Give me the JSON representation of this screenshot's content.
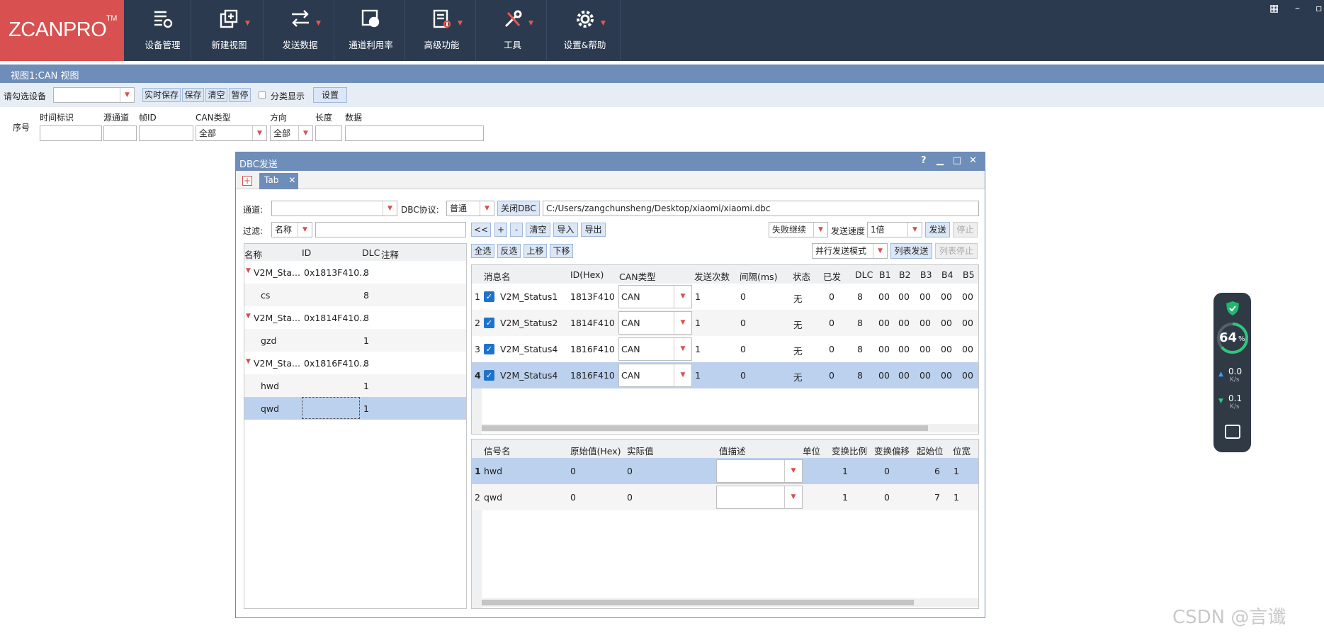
{
  "app": {
    "logo": "ZCANPRO",
    "logo_tm": "TM",
    "toolbar": [
      {
        "label": "设备管理",
        "icon": "device-manage-icon",
        "caret": false
      },
      {
        "label": "新建视图",
        "icon": "new-view-icon",
        "caret": true
      },
      {
        "label": "发送数据",
        "icon": "send-data-icon",
        "caret": true
      },
      {
        "label": "通道利用率",
        "icon": "channel-usage-icon",
        "caret": false
      },
      {
        "label": "高级功能",
        "icon": "advanced-icon",
        "caret": true
      },
      {
        "label": "工具",
        "icon": "tools-icon",
        "caret": true
      },
      {
        "label": "设置&帮助",
        "icon": "settings-icon",
        "caret": true
      }
    ],
    "window_controls": [
      "layout-icon",
      "minimize-icon",
      "restore-icon"
    ]
  },
  "view": {
    "title": "视图1:CAN 视图",
    "device_label": "请勾选设备",
    "device_value": "",
    "buttons": [
      "实时保存",
      "保存",
      "清空",
      "暂停"
    ],
    "classify_label": "分类显示",
    "settings_btn": "设置",
    "filter_headers": {
      "seq": "序号",
      "time": "时间标识",
      "src": "源通道",
      "frame_id": "帧ID",
      "can_type": "CAN类型",
      "direction": "方向",
      "length": "长度",
      "data": "数据"
    },
    "can_type_value": "全部",
    "direction_value": "全部"
  },
  "dialog": {
    "title": "DBC发送",
    "tab_label": "Tab",
    "channel_label": "通道:",
    "channel_value": "",
    "protocol_label": "DBC协议:",
    "protocol_value": "普通",
    "close_dbc_btn": "关闭DBC",
    "dbc_path": "C:/Users/zangchunsheng/Desktop/xiaomi/xiaomi.dbc",
    "filter_label": "过滤:",
    "filter_field": "名称",
    "filter_value": "",
    "nav_buttons": [
      "<<",
      "+",
      "-",
      "清空",
      "导入",
      "导出"
    ],
    "fail_mode": "失败继续",
    "speed_label": "发送速度",
    "speed_value": "1倍",
    "send_btn": "发送",
    "stop_btn": "停止",
    "sel_buttons": [
      "全选",
      "反选",
      "上移",
      "下移"
    ],
    "mode_value": "并行发送模式",
    "list_send_btn": "列表发送",
    "list_stop_btn": "列表停止",
    "tree_headers": [
      "名称",
      "ID",
      "DLC",
      "注释"
    ],
    "tree_rows": [
      {
        "name": "V2M_Sta...",
        "id": "0x1813F410...",
        "dlc": "8",
        "parent": true
      },
      {
        "name": "cs",
        "id": "",
        "dlc": "8",
        "parent": false
      },
      {
        "name": "V2M_Sta...",
        "id": "0x1814F410...",
        "dlc": "8",
        "parent": true
      },
      {
        "name": "gzd",
        "id": "",
        "dlc": "1",
        "parent": false
      },
      {
        "name": "V2M_Sta...",
        "id": "0x1816F410...",
        "dlc": "8",
        "parent": true
      },
      {
        "name": "hwd",
        "id": "",
        "dlc": "1",
        "parent": false
      },
      {
        "name": "qwd",
        "id": "",
        "dlc": "1",
        "parent": false,
        "selected": true
      }
    ],
    "msg_headers": [
      "消息名",
      "ID(Hex)",
      "CAN类型",
      "发送次数",
      "间隔(ms)",
      "状态",
      "已发",
      "DLC",
      "B1",
      "B2",
      "B3",
      "B4",
      "B5"
    ],
    "msg_rows": [
      {
        "no": "1",
        "name": "V2M_Status1",
        "id": "1813F410",
        "can": "CAN",
        "count": "1",
        "interval": "0",
        "status": "无",
        "sent": "0",
        "dlc": "8",
        "b": [
          "00",
          "00",
          "00",
          "00",
          "00"
        ]
      },
      {
        "no": "2",
        "name": "V2M_Status2",
        "id": "1814F410",
        "can": "CAN",
        "count": "1",
        "interval": "0",
        "status": "无",
        "sent": "0",
        "dlc": "8",
        "b": [
          "00",
          "00",
          "00",
          "00",
          "00"
        ]
      },
      {
        "no": "3",
        "name": "V2M_Status4",
        "id": "1816F410",
        "can": "CAN",
        "count": "1",
        "interval": "0",
        "status": "无",
        "sent": "0",
        "dlc": "8",
        "b": [
          "00",
          "00",
          "00",
          "00",
          "00"
        ]
      },
      {
        "no": "4",
        "name": "V2M_Status4",
        "id": "1816F410",
        "can": "CAN",
        "count": "1",
        "interval": "0",
        "status": "无",
        "sent": "0",
        "dlc": "8",
        "b": [
          "00",
          "00",
          "00",
          "00",
          "00"
        ],
        "selected": true
      }
    ],
    "sig_headers": [
      "信号名",
      "原始值(Hex)",
      "实际值",
      "值描述",
      "单位",
      "变换比例",
      "变换偏移",
      "起始位",
      "位宽"
    ],
    "sig_rows": [
      {
        "no": "1",
        "name": "hwd",
        "raw": "0",
        "actual": "0",
        "desc": "",
        "unit": "",
        "scale": "1",
        "offset": "0",
        "start": "6",
        "width": "1",
        "selected": true
      },
      {
        "no": "2",
        "name": "qwd",
        "raw": "0",
        "actual": "0",
        "desc": "",
        "unit": "",
        "scale": "1",
        "offset": "0",
        "start": "7",
        "width": "1"
      }
    ]
  },
  "widget": {
    "percent": "64",
    "percent_unit": "%",
    "up_value": "0.0",
    "up_unit": "K/s",
    "down_value": "0.1",
    "down_unit": "K/s",
    "load_fraction": 0.64
  },
  "watermark": "CSDN @言谶"
}
